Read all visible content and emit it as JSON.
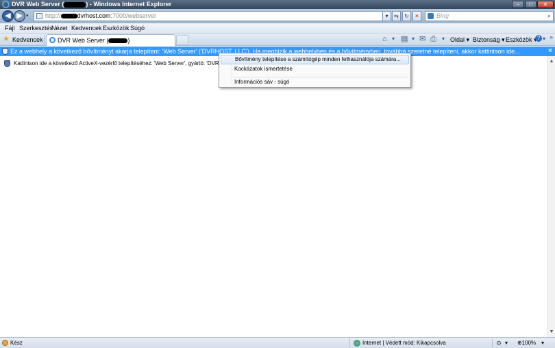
{
  "window": {
    "title_prefix": "DVR Web Server (",
    "title_suffix": ") - Windows Internet Explorer",
    "minimize_glyph": "–",
    "maximize_glyph": "□",
    "close_glyph": "✕"
  },
  "address": {
    "url_prefix": "http://",
    "url_host": "dvrhost.com",
    "url_path": ":7000/webserver",
    "search_placeholder": "Bing",
    "dropdown_glyph": "▾",
    "refresh_glyph": "↻",
    "compat_glyph": "⇆",
    "stop_glyph": "✕",
    "search_glyph": "⌕"
  },
  "menu": {
    "items": [
      "Fájl",
      "Szerkesztés",
      "Nézet",
      "Kedvencek",
      "Eszközök",
      "Súgó"
    ]
  },
  "favorites": {
    "label": "Kedvencek",
    "tab_title_prefix": "DVR Web Server (",
    "tab_title_suffix": ")"
  },
  "commandbar": {
    "page_label": "Oldal ▾",
    "security_label": "Biztonság ▾",
    "tools_label": "Eszközök ▾",
    "home_glyph": "⌂",
    "feeds_glyph": "▤",
    "mail_glyph": "✉",
    "print_glyph": "⎙",
    "help_glyph": "?",
    "chevron": "»"
  },
  "infobar": {
    "message": "Ez a webhely a következő bővítményt akarja telepíteni: 'Web Server' ('DVRHOST, LLC'). Ha megbízik a webhelyben és a bővítményben, továbbá szeretné telepíteni, akkor kattintson ide...",
    "close": "×"
  },
  "content": {
    "notice": "Kattintson ide a következő ActiveX-vezérlő telepítéséhez: 'Web Server', gyártó: 'DVRHOST, LLC'..."
  },
  "context_menu": {
    "items": [
      "Bővítmény telepítése a számítógép minden felhasználója számára...",
      "Kockázatok ismertetése",
      "Információs sáv - súgó"
    ]
  },
  "statusbar": {
    "status": "Kész",
    "zone": "Internet | Védett mód: Kikapcsolva",
    "zoom": "100%",
    "dropdown_glyph": "▾"
  },
  "scrollbar": {
    "up_glyph": "▲",
    "down_glyph": "▼"
  }
}
